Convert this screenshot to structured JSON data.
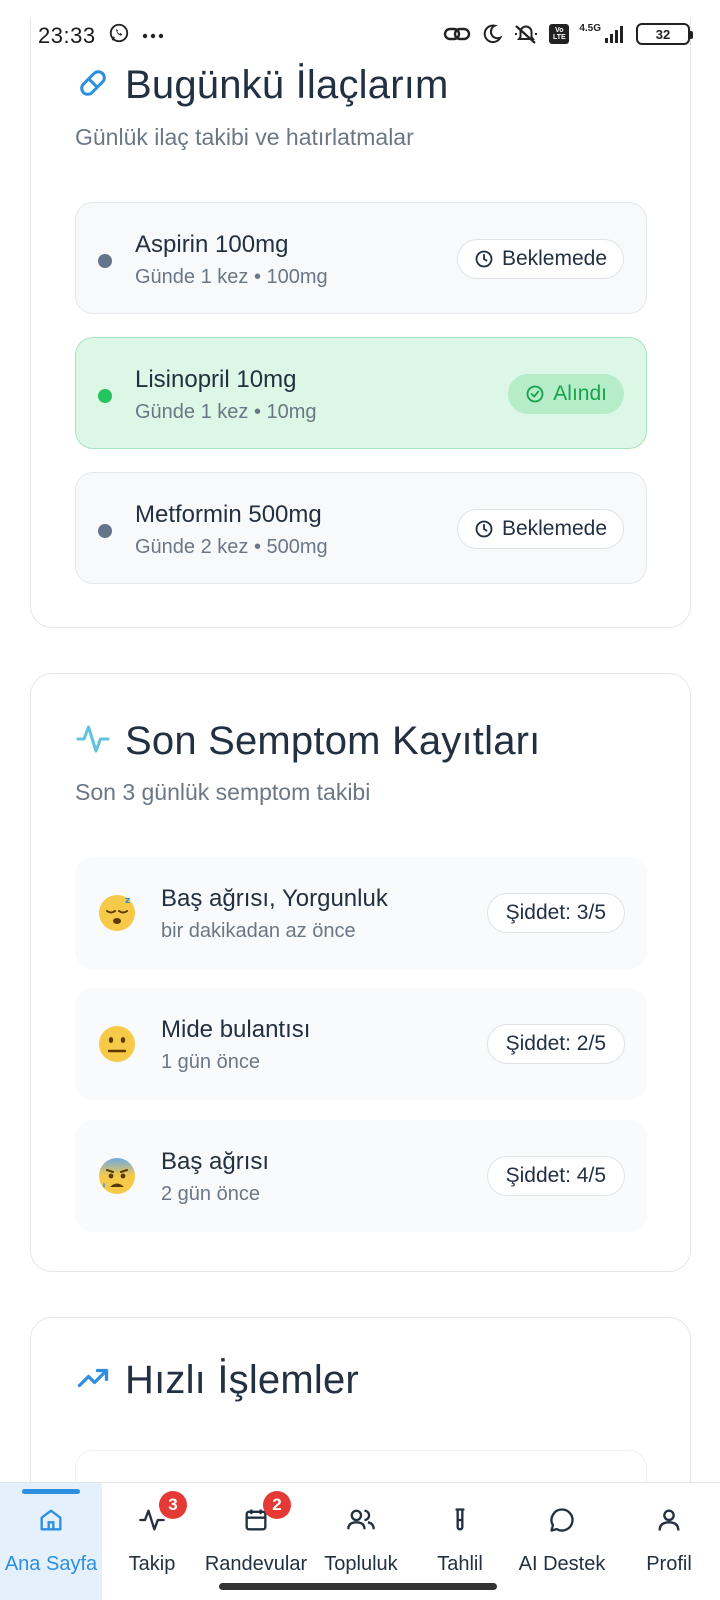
{
  "status_bar": {
    "time": "23:33",
    "network_label": "4.5G",
    "volte_label": "Vo LTE",
    "battery": "32",
    "icons": [
      "whatsapp-icon",
      "more-dots-icon",
      "link-icon",
      "moon-icon",
      "silent-icon",
      "signal-icon",
      "battery-icon"
    ]
  },
  "medications": {
    "icon": "pill-icon",
    "title": "Bugünkü İlaçlarım",
    "subtitle": "Günlük ilaç takibi ve hatırlatmalar",
    "items": [
      {
        "name": "Aspirin 100mg",
        "detail": "Günde 1 kez • 100mg",
        "status": "Beklemede",
        "taken": false
      },
      {
        "name": "Lisinopril 10mg",
        "detail": "Günde 1 kez • 10mg",
        "status": "Alındı",
        "taken": true
      },
      {
        "name": "Metformin 500mg",
        "detail": "Günde 2 kez • 500mg",
        "status": "Beklemede",
        "taken": false
      }
    ],
    "colors": {
      "pending_dot": "#64748b",
      "taken_dot": "#22c55e",
      "taken_bg": "#dcf7e5",
      "taken_text": "#16a34a"
    }
  },
  "symptoms": {
    "icon": "activity-icon",
    "title": "Son Semptom Kayıtları",
    "subtitle": "Son 3 günlük semptom takibi",
    "items": [
      {
        "emoji": "sleepy-face-icon",
        "name": "Baş ağrısı, Yorgunluk",
        "time": "bir dakikadan az önce",
        "severity": "Şiddet: 3/5"
      },
      {
        "emoji": "neutral-face-icon",
        "name": "Mide bulantısı",
        "time": "1 gün önce",
        "severity": "Şiddet: 2/5"
      },
      {
        "emoji": "anxious-face-icon",
        "name": "Baş ağrısı",
        "time": "2 gün önce",
        "severity": "Şiddet: 4/5"
      }
    ]
  },
  "quick_actions": {
    "icon": "trending-up-icon",
    "title": "Hızlı İşlemler"
  },
  "bottom_nav": {
    "accent": "#2d8fe0",
    "items": [
      {
        "label": "Ana Sayfa",
        "icon": "home-icon",
        "active": true
      },
      {
        "label": "Takip",
        "icon": "activity-icon",
        "badge": "3"
      },
      {
        "label": "Randevular",
        "icon": "calendar-icon",
        "badge": "2"
      },
      {
        "label": "Topluluk",
        "icon": "users-icon"
      },
      {
        "label": "Tahlil",
        "icon": "test-tube-icon"
      },
      {
        "label": "AI Destek",
        "icon": "chat-icon"
      },
      {
        "label": "Profil",
        "icon": "user-icon"
      }
    ]
  }
}
